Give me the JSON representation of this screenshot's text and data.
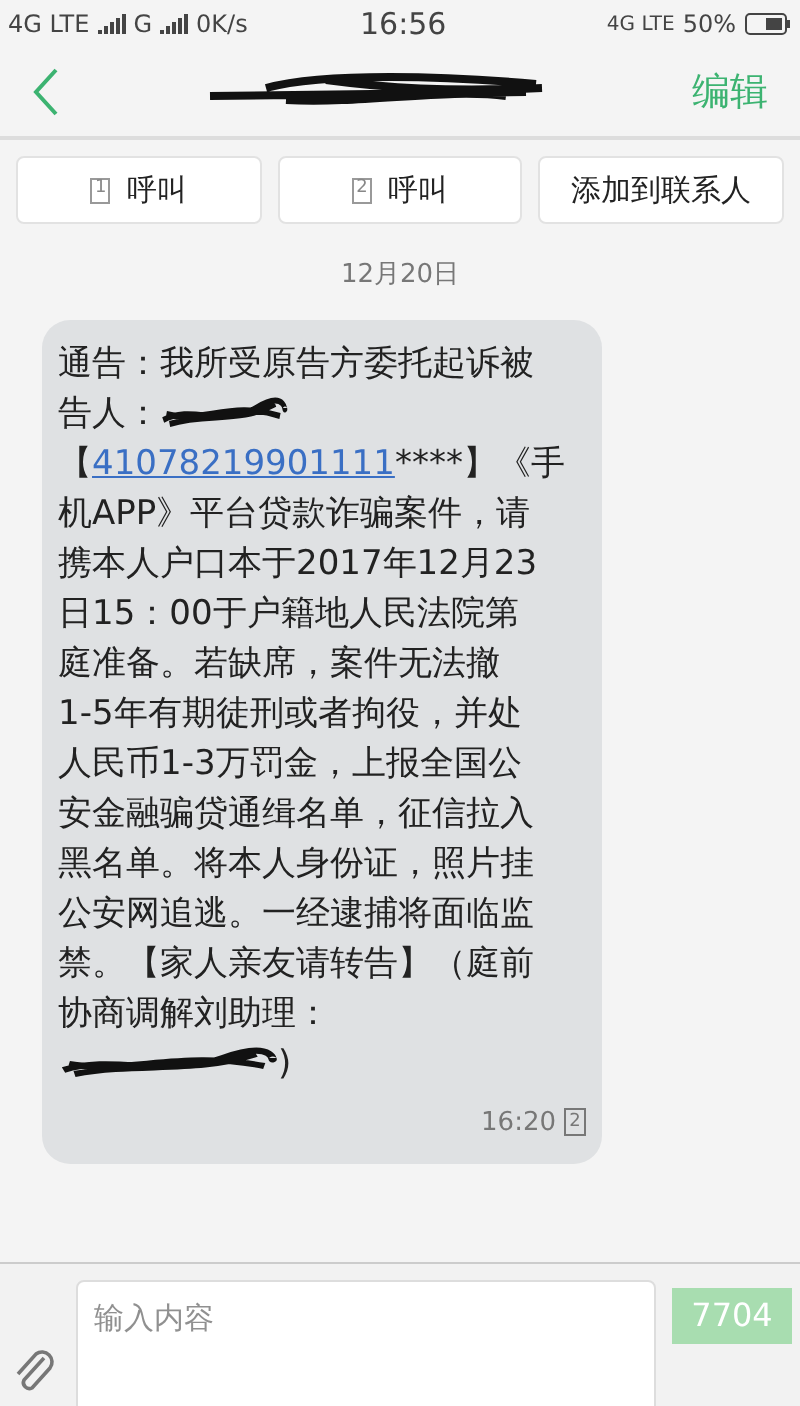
{
  "status_bar": {
    "left": [
      "4G LTE",
      "G",
      "0K/s"
    ],
    "time": "16:56",
    "network": "4G LTE",
    "battery": "50%"
  },
  "header": {
    "action": "编辑"
  },
  "actions": [
    {
      "sim": "1",
      "label": "呼叫"
    },
    {
      "sim": "2",
      "label": "呼叫"
    },
    {
      "label": "添加到联系人"
    }
  ],
  "date": "12月20日",
  "message": {
    "lines": [
      {
        "kind": "text",
        "text": "通告：我所受原告方委托起诉被"
      },
      {
        "kind": "redacted",
        "text": "告人："
      },
      {
        "kind": "link",
        "before": "【",
        "link": "41078219901111",
        "after": "****】《手"
      },
      {
        "kind": "text",
        "text": "机APP》平台贷款诈骗案件，请"
      },
      {
        "kind": "text",
        "text": "携本人户口本于2017年12月23"
      },
      {
        "kind": "text",
        "text": "日15：00于户籍地人民法院第"
      },
      {
        "kind": "text",
        "text": "庭准备。若缺席，案件无法撤"
      },
      {
        "kind": "text",
        "text": "1-5年有期徒刑或者拘役，并处"
      },
      {
        "kind": "text",
        "text": "人民币1-3万罚金，上报全国公"
      },
      {
        "kind": "text",
        "text": "安金融骗贷通缉名单，征信拉入"
      },
      {
        "kind": "text",
        "text": "黑名单。将本人身份证，照片挂"
      },
      {
        "kind": "text",
        "text": "公安网追逃。一经逮捕将面临监"
      },
      {
        "kind": "text",
        "text": "禁。【家人亲友请转告】（庭前"
      },
      {
        "kind": "text",
        "text": "协商调解刘助理："
      },
      {
        "kind": "redacted_before",
        "text": ")"
      }
    ],
    "time": "16:20",
    "sim": "2"
  },
  "composer": {
    "placeholder": "输入内容",
    "send": "7704"
  }
}
